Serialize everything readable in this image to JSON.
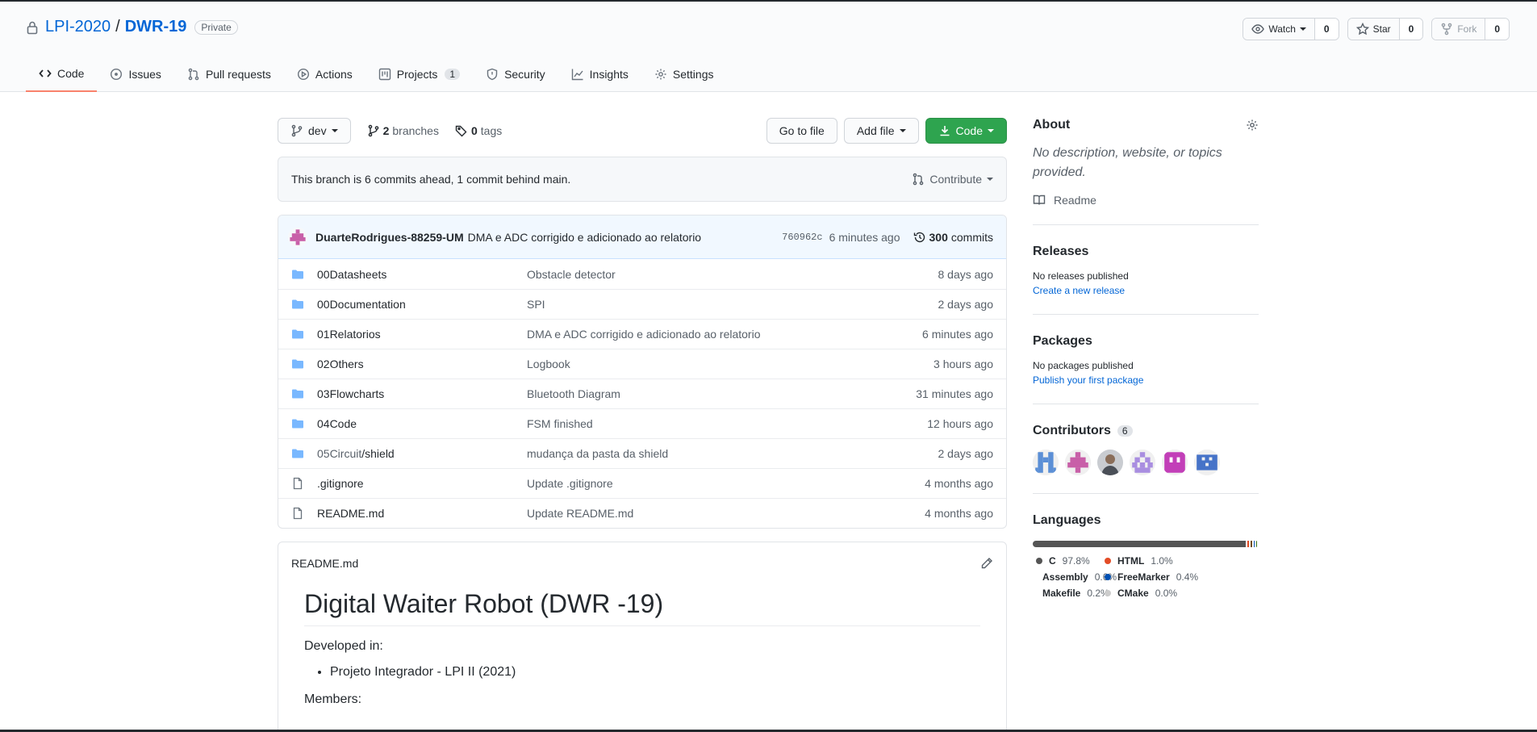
{
  "repo": {
    "owner": "LPI-2020",
    "separator": "/",
    "name": "DWR-19",
    "visibility": "Private"
  },
  "header_actions": [
    {
      "label": "Watch",
      "count": "0",
      "icon": "eye-icon"
    },
    {
      "label": "Star",
      "count": "0",
      "icon": "star-icon"
    },
    {
      "label": "Fork",
      "count": "0",
      "icon": "fork-icon"
    }
  ],
  "tabs": [
    {
      "label": "Code",
      "icon": "code-icon"
    },
    {
      "label": "Issues",
      "icon": "issue-icon"
    },
    {
      "label": "Pull requests",
      "icon": "pull-request-icon"
    },
    {
      "label": "Actions",
      "icon": "play-icon"
    },
    {
      "label": "Projects",
      "icon": "project-icon",
      "badge": "1"
    },
    {
      "label": "Security",
      "icon": "shield-icon"
    },
    {
      "label": "Insights",
      "icon": "graph-icon"
    },
    {
      "label": "Settings",
      "icon": "gear-icon"
    }
  ],
  "toolbar": {
    "branch": "dev",
    "branches_count": "2",
    "branches_label": "branches",
    "tags_count": "0",
    "tags_label": "tags",
    "go_to_file": "Go to file",
    "add_file": "Add file",
    "code": "Code"
  },
  "branch_status": {
    "text": "This branch is 6 commits ahead, 1 commit behind main.",
    "contribute": "Contribute"
  },
  "last_commit": {
    "author": "DuarteRodrigues-88259-UM",
    "message": "DMA e ADC corrigido e adicionado ao relatorio",
    "sha": "760962c",
    "ago": "6 minutes ago",
    "commits_count": "300",
    "commits_label": "commits"
  },
  "files": [
    {
      "type": "folder",
      "name": "00Datasheets",
      "message": "Obstacle detector",
      "age": "8 days ago"
    },
    {
      "type": "folder",
      "name": "00Documentation",
      "message": "SPI",
      "age": "2 days ago"
    },
    {
      "type": "folder",
      "name": "01Relatorios",
      "message": "DMA e ADC corrigido e adicionado ao relatorio",
      "age": "6 minutes ago"
    },
    {
      "type": "folder",
      "name": "02Others",
      "message": "Logbook",
      "age": "3 hours ago"
    },
    {
      "type": "folder",
      "name": "03Flowcharts",
      "message": "Bluetooth Diagram",
      "age": "31 minutes ago"
    },
    {
      "type": "folder",
      "name": "04Code",
      "message": "FSM finished",
      "age": "12 hours ago"
    },
    {
      "type": "folder",
      "name": "05Circuit",
      "name_suffix": "/shield",
      "message": "mudança da pasta da shield",
      "age": "2 days ago"
    },
    {
      "type": "file",
      "name": ".gitignore",
      "message": "Update .gitignore",
      "age": "4 months ago"
    },
    {
      "type": "file",
      "name": "README.md",
      "message": "Update README.md",
      "age": "4 months ago"
    }
  ],
  "readme": {
    "filename": "README.md",
    "title": "Digital Waiter Robot (DWR -19)",
    "developed_in": "Developed in:",
    "bullet": "Projeto Integrador - LPI II (2021)",
    "members": "Members:"
  },
  "sidebar": {
    "about_title": "About",
    "about_desc": "No description, website, or topics provided.",
    "readme_label": "Readme",
    "releases_title": "Releases",
    "releases_text": "No releases published",
    "releases_link": "Create a new release",
    "packages_title": "Packages",
    "packages_text": "No packages published",
    "packages_link": "Publish your first package",
    "contributors_title": "Contributors",
    "contributors_count": "6",
    "languages_title": "Languages"
  },
  "languages": [
    {
      "name": "C",
      "percent": "97.8%",
      "value": 97.8,
      "color": "#555555"
    },
    {
      "name": "HTML",
      "percent": "1.0%",
      "value": 1.0,
      "color": "#e34c26"
    },
    {
      "name": "Assembly",
      "percent": "0.6%",
      "value": 0.6,
      "color": "#6E4C13"
    },
    {
      "name": "FreeMarker",
      "percent": "0.4%",
      "value": 0.4,
      "color": "#0050b2"
    },
    {
      "name": "Makefile",
      "percent": "0.2%",
      "value": 0.2,
      "color": "#427819"
    },
    {
      "name": "CMake",
      "percent": "0.0%",
      "value": 0.0,
      "color": "#DA3434"
    }
  ],
  "colors": {
    "link": "#0366d6",
    "green_button": "#2ea44f",
    "active_tab_underline": "#f9826c",
    "folder": "#79b8ff"
  }
}
